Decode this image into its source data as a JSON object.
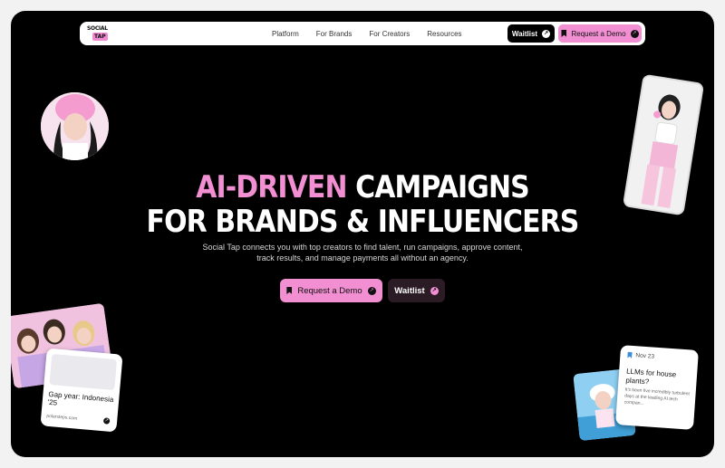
{
  "nav": {
    "logo_top": "SOCIAL",
    "logo_bottom": "TAP",
    "links": [
      "Platform",
      "For Brands",
      "For Creators",
      "Resources"
    ],
    "waitlist_label": "Waitlist",
    "demo_label": "Request a Demo"
  },
  "hero": {
    "title_pink": "AI-DRIVEN",
    "title_rest1": " CAMPAIGNS",
    "title_line2": "FOR BRANDS & INFLUENCERS",
    "subtitle": "Social Tap connects you with top creators to find talent, run campaigns, approve content, track results, and manage payments all without an agency.",
    "demo_label": "Request a Demo",
    "waitlist_label": "Waitlist"
  },
  "cards": {
    "left": {
      "title": "Gap year: Indonesia '25",
      "source": "polarsteps.com"
    },
    "right": {
      "date": "Nov 23",
      "title": "LLMs for house plants?",
      "preview": "It's been five incredibly turbulent days at the leading AI tech compan..."
    }
  },
  "colors": {
    "accent": "#f18fd2",
    "background": "#000000"
  }
}
